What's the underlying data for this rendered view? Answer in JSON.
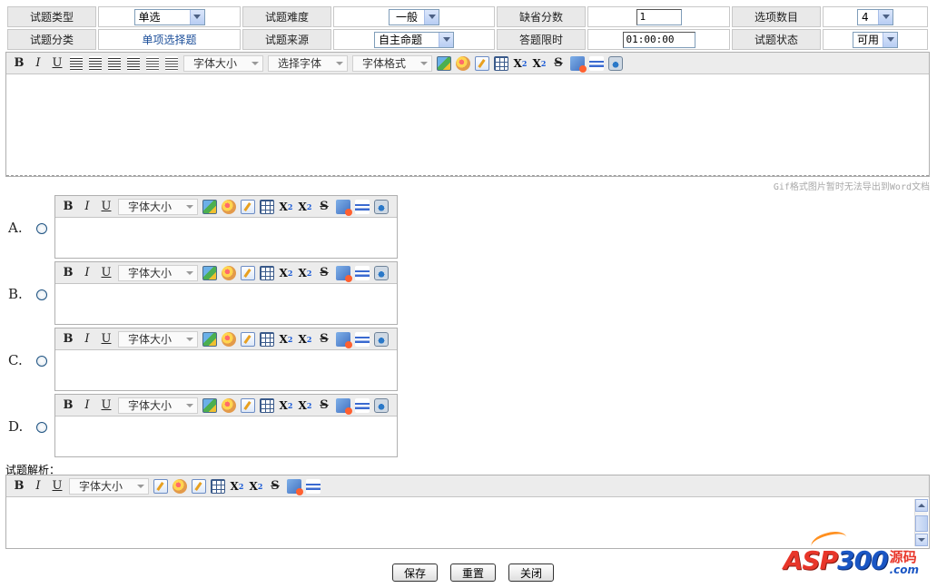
{
  "form": {
    "row1": {
      "type_label": "试题类型",
      "type_value": "单选",
      "difficulty_label": "试题难度",
      "difficulty_value": "一般",
      "default_score_label": "缺省分数",
      "default_score_value": "1",
      "option_count_label": "选项数目",
      "option_count_value": "4"
    },
    "row2": {
      "category_label": "试题分类",
      "category_value": "单项选择题",
      "source_label": "试题来源",
      "source_value": "自主命题",
      "time_limit_label": "答题限时",
      "time_limit_value": "01:00:00",
      "status_label": "试题状态",
      "status_value": "可用"
    }
  },
  "main_editor": {
    "font_size": "字体大小",
    "font_family": "选择字体",
    "font_format": "字体格式"
  },
  "note": "Gif格式图片暂时无法导出到Word文档",
  "options": [
    {
      "letter": "A.",
      "font_size": "字体大小"
    },
    {
      "letter": "B.",
      "font_size": "字体大小"
    },
    {
      "letter": "C.",
      "font_size": "字体大小"
    },
    {
      "letter": "D.",
      "font_size": "字体大小"
    }
  ],
  "analysis": {
    "label": "试题解析：",
    "font_size": "字体大小"
  },
  "buttons": {
    "save": "保存",
    "reset": "重置",
    "close": "关闭"
  },
  "brand": {
    "main_text": "ASP",
    "digits": "300",
    "cn": "源码",
    "com": ".com"
  },
  "toolbar_glyphs": {
    "bold": "B",
    "italic": "I",
    "underline": "U",
    "subscript": "X",
    "superscript": "X",
    "strike": "S"
  }
}
